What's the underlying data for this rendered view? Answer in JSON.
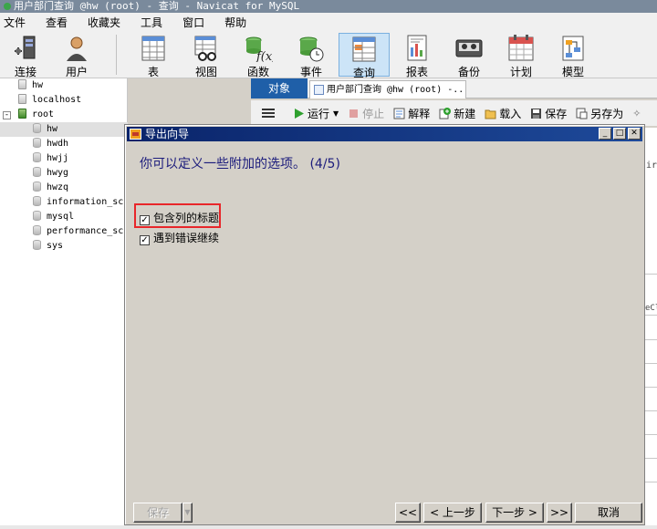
{
  "window": {
    "title": "用户部门查询 @hw (root) - 查询 - Navicat for MySQL"
  },
  "menu": [
    "文件",
    "查看",
    "收藏夹",
    "工具",
    "窗口",
    "帮助"
  ],
  "toolbar": {
    "items": [
      {
        "label": "连接",
        "icon": "connection-icon"
      },
      {
        "label": "用户",
        "icon": "user-icon"
      },
      {
        "label": "表",
        "icon": "table-icon"
      },
      {
        "label": "视图",
        "icon": "view-icon"
      },
      {
        "label": "函数",
        "icon": "function-icon"
      },
      {
        "label": "事件",
        "icon": "event-icon"
      },
      {
        "label": "查询",
        "icon": "query-icon",
        "active": true
      },
      {
        "label": "报表",
        "icon": "report-icon"
      },
      {
        "label": "备份",
        "icon": "backup-icon"
      },
      {
        "label": "计划",
        "icon": "schedule-icon"
      },
      {
        "label": "模型",
        "icon": "model-icon"
      }
    ]
  },
  "sidebar": {
    "connections": [
      {
        "label": "hw"
      },
      {
        "label": "localhost"
      },
      {
        "label": "root",
        "expand": "-"
      }
    ],
    "databases": [
      "hw",
      "hwdh",
      "hwjj",
      "hwyg",
      "hwzq",
      "information_schema",
      "mysql",
      "performance_schema",
      "sys"
    ]
  },
  "tabs": {
    "objects_label": "对象",
    "query_label": "用户部门查询 @hw (root) -..."
  },
  "query_toolbar": {
    "run": "运行",
    "stop": "停止",
    "explain": "解释",
    "new": "新建",
    "load": "载入",
    "save": "保存",
    "save_as": "另存为"
  },
  "dialog": {
    "title": "导出向导",
    "heading": "你可以定义一些附加的选项。 (4/5)",
    "options": [
      {
        "label": "包含列的标题",
        "checked": true
      },
      {
        "label": "遇到错误继续",
        "checked": true
      }
    ],
    "buttons": {
      "save": "保存",
      "first": "<<",
      "prev": "< 上一步",
      "next": "下一步 >",
      "last": ">>",
      "cancel": "取消"
    }
  },
  "background_fragments": {
    "right_text_1": "ir",
    "right_text_2": "eCl"
  }
}
